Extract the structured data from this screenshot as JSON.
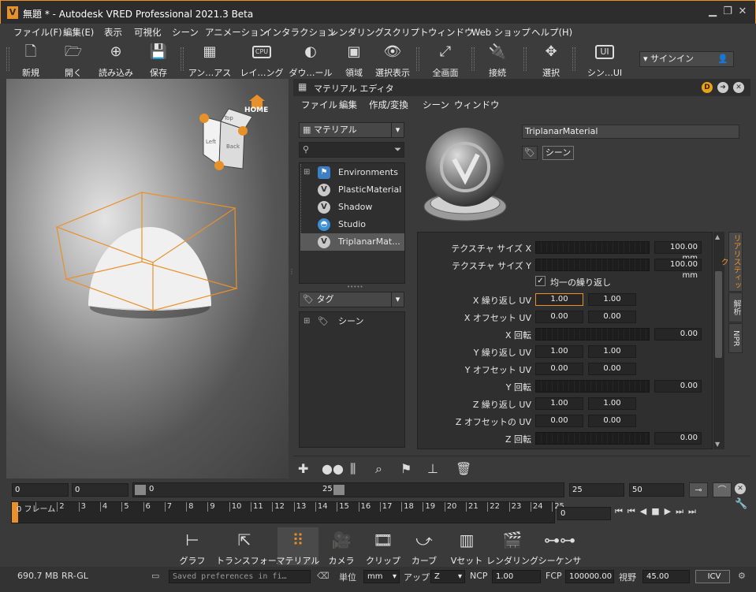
{
  "window": {
    "title": "無題 * - Autodesk VRED Professional 2021.3 Beta"
  },
  "menu": [
    "ファイル(F)",
    "編集(E)",
    "表示",
    "可視化",
    "シーン",
    "アニメーション",
    "インタラクション",
    "レンダリング",
    "スクリプト",
    "ウィンドウ",
    "Web ショップ",
    "ヘルプ(H)"
  ],
  "toolbar": {
    "buttons": [
      {
        "label": "新規",
        "icon": "new-file-icon"
      },
      {
        "label": "開く",
        "icon": "open-folder-icon"
      },
      {
        "label": "読み込み",
        "icon": "import-icon"
      },
      {
        "label": "保存",
        "icon": "save-icon"
      },
      {
        "label": "アン…アス",
        "icon": "antialias-icon"
      },
      {
        "label": "レイ…ング",
        "icon": "cpu-raytracing-icon"
      },
      {
        "label": "ダウ…ール",
        "icon": "downscale-icon"
      },
      {
        "label": "領域",
        "icon": "region-icon"
      },
      {
        "label": "選択表示",
        "icon": "eye-icon"
      },
      {
        "label": "全画面",
        "icon": "fullscreen-icon"
      },
      {
        "label": "接続",
        "icon": "plug-icon"
      },
      {
        "label": "選択",
        "icon": "select-icon"
      },
      {
        "label": "シン…UI",
        "icon": "ui-icon"
      }
    ],
    "cpu_text": "CPU",
    "ui_text": "UI",
    "signin": "サインイン"
  },
  "viewport": {
    "home_label": "HOME",
    "cube_faces": [
      "Top",
      "Left",
      "Back"
    ]
  },
  "material_editor": {
    "title": "マテリアル エディタ",
    "menu": [
      "ファイル",
      "編集",
      "作成/変換",
      "シーン",
      "ウィンドウ"
    ],
    "filter_combo": "マテリアル",
    "search_placeholder": "",
    "tree": [
      {
        "label": "Environments",
        "icon": "environment-icon"
      },
      {
        "label": "PlasticMaterial",
        "icon": "v-material-icon"
      },
      {
        "label": "Shadow",
        "icon": "v-material-icon"
      },
      {
        "label": "Studio",
        "icon": "studio-icon"
      },
      {
        "label": "TriplanarMat...",
        "icon": "v-material-icon",
        "selected": true
      }
    ],
    "tag_combo": "タグ",
    "tag_tree": [
      {
        "label": "シーン"
      }
    ],
    "material_name": "TriplanarMaterial",
    "scene_tag": "シーン",
    "properties": {
      "texture_size_x": {
        "label": "テクスチャ サイズ X",
        "value": "100.00 mm"
      },
      "texture_size_y": {
        "label": "テクスチャ サイズ Y",
        "value": "100.00 mm"
      },
      "uniform_repeat": {
        "label": "均一の繰り返し",
        "checked": true
      },
      "x_repeat": {
        "label": "X 繰り返し UV",
        "u": "1.00",
        "v": "1.00"
      },
      "x_offset": {
        "label": "X オフセット UV",
        "u": "0.00",
        "v": "0.00"
      },
      "x_rotate": {
        "label": "X 回転",
        "value": "0.00"
      },
      "y_repeat": {
        "label": "Y 繰り返し UV",
        "u": "1.00",
        "v": "1.00"
      },
      "y_offset": {
        "label": "Y オフセット UV",
        "u": "0.00",
        "v": "0.00"
      },
      "y_rotate": {
        "label": "Y 回転",
        "value": "0.00"
      },
      "z_repeat": {
        "label": "Z 繰り返し UV",
        "u": "1.00",
        "v": "1.00"
      },
      "z_offset": {
        "label": "Z オフセットの UV",
        "u": "0.00",
        "v": "0.00"
      },
      "z_rotate": {
        "label": "Z 回転",
        "value": "0.00"
      }
    },
    "side_tabs": [
      "リアリスティック",
      "解析",
      "NPR"
    ]
  },
  "timeline": {
    "start": "0",
    "current": "0",
    "slider_start": "0",
    "slider_end": "25",
    "end_a": "25",
    "end_b": "50",
    "frame_field": "0",
    "frame_label": "0 フレーム",
    "ticks": [
      "1",
      "2",
      "3",
      "4",
      "5",
      "6",
      "7",
      "8",
      "9",
      "10",
      "11",
      "12",
      "13",
      "14",
      "15",
      "16",
      "17",
      "18",
      "19",
      "20",
      "21",
      "22",
      "23",
      "24",
      "25"
    ]
  },
  "modules": [
    {
      "label": "グラフ",
      "icon": "graph-icon"
    },
    {
      "label": "トランスフォーム",
      "icon": "transform-icon"
    },
    {
      "label": "マテリアル",
      "icon": "material-icon",
      "active": true
    },
    {
      "label": "カメラ",
      "icon": "camera-icon"
    },
    {
      "label": "クリップ",
      "icon": "clip-icon"
    },
    {
      "label": "カーブ",
      "icon": "curve-icon"
    },
    {
      "label": "Vセット",
      "icon": "vset-icon"
    },
    {
      "label": "レンダリング",
      "icon": "clapper-icon"
    },
    {
      "label": "シーケンサ",
      "icon": "sequencer-icon"
    }
  ],
  "status": {
    "memory": "690.7 MB",
    "renderer": "RR-GL",
    "message": "Saved preferences in fi…",
    "unit_label": "単位",
    "unit": "mm",
    "up_label": "アップ",
    "up": "Z",
    "ncp_label": "NCP",
    "ncp": "1.00",
    "fcp_label": "FCP",
    "fcp": "100000.00",
    "fov_label": "視野",
    "fov": "45.00",
    "icv": "ICV"
  },
  "colors": {
    "accent": "#e8912a",
    "bg": "#3a3a3a"
  }
}
